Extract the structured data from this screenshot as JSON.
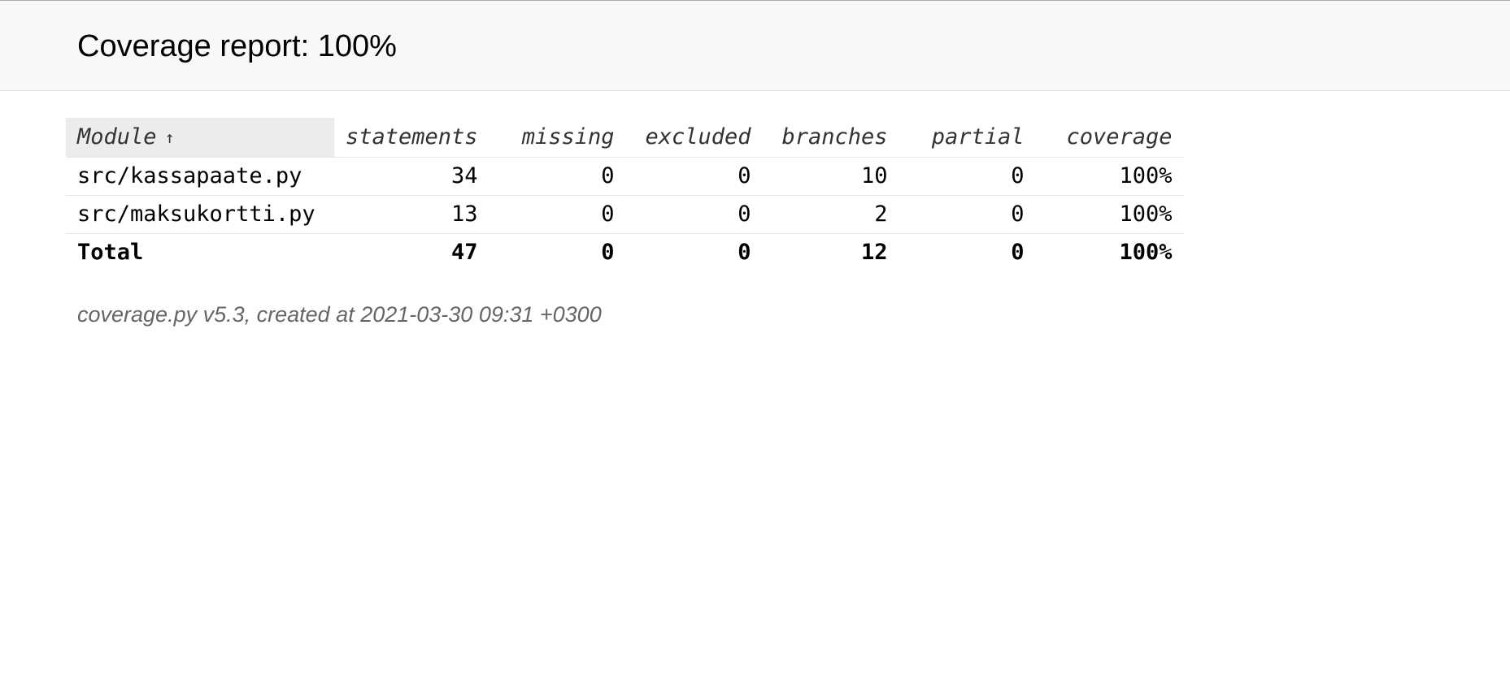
{
  "header": {
    "title": "Coverage report: 100%"
  },
  "table": {
    "columns": {
      "module": "Module",
      "sort_indicator": "↑",
      "statements": "statements",
      "missing": "missing",
      "excluded": "excluded",
      "branches": "branches",
      "partial": "partial",
      "coverage": "coverage"
    },
    "rows": [
      {
        "module": "src/kassapaate.py",
        "statements": "34",
        "missing": "0",
        "excluded": "0",
        "branches": "10",
        "partial": "0",
        "coverage": "100%"
      },
      {
        "module": "src/maksukortti.py",
        "statements": "13",
        "missing": "0",
        "excluded": "0",
        "branches": "2",
        "partial": "0",
        "coverage": "100%"
      }
    ],
    "total": {
      "module": "Total",
      "statements": "47",
      "missing": "0",
      "excluded": "0",
      "branches": "12",
      "partial": "0",
      "coverage": "100%"
    }
  },
  "footer": {
    "text": "coverage.py v5.3, created at 2021-03-30 09:31 +0300"
  }
}
